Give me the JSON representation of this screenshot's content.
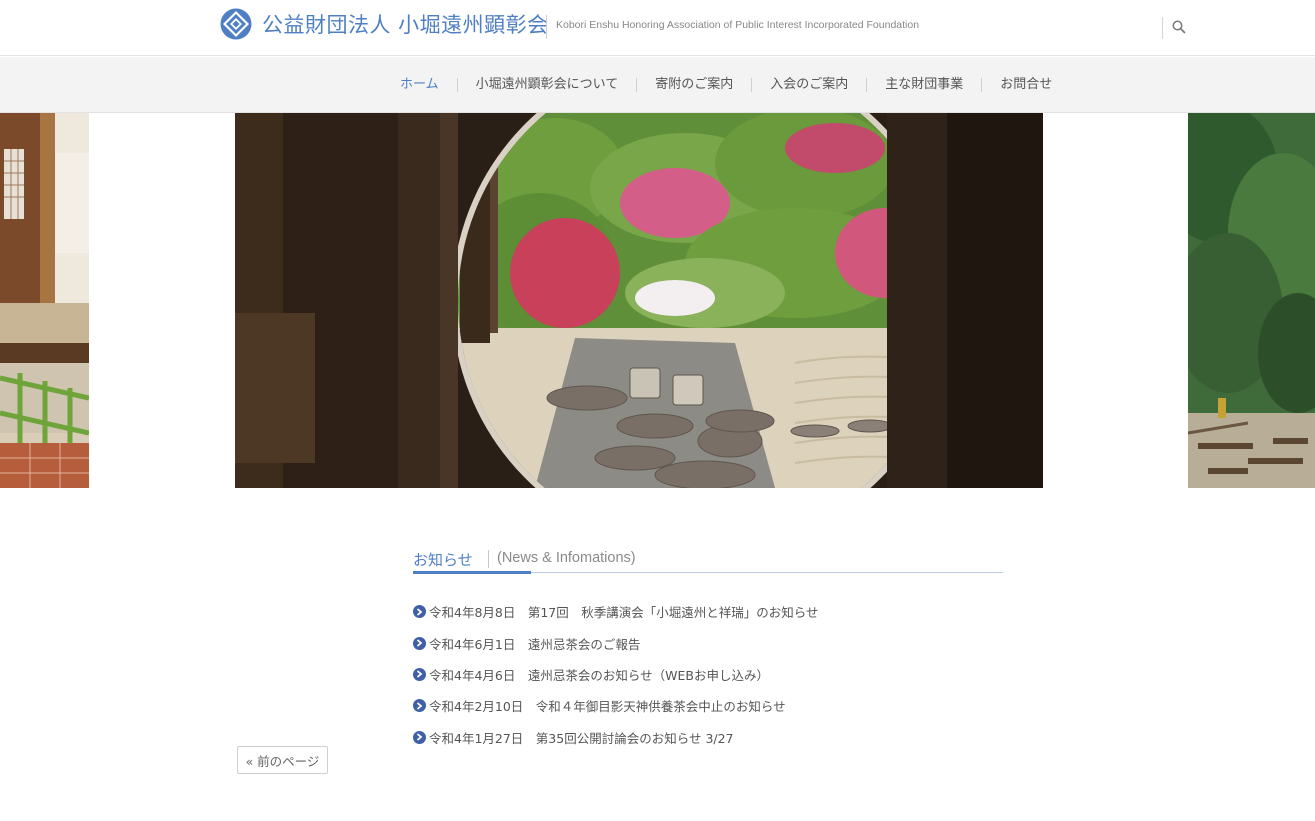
{
  "header": {
    "title": "公益財団法人 小堀遠州顕彰会",
    "subtitle": "Kobori Enshu Honoring Association of Public Interest Incorporated Foundation",
    "search_icon": "search-icon",
    "logo_icon": "diamond-crest-icon"
  },
  "nav": {
    "items": [
      {
        "label": "ホーム",
        "active": true
      },
      {
        "label": "小堀遠州顕彰会について",
        "active": false
      },
      {
        "label": "寄附のご案内",
        "active": false
      },
      {
        "label": "入会のご案内",
        "active": false
      },
      {
        "label": "主な財団事業",
        "active": false
      },
      {
        "label": "お問合せ",
        "active": false
      }
    ]
  },
  "news": {
    "title": "お知らせ",
    "subtitle": "(News & Infomations)",
    "items": [
      {
        "text": "令和4年8月8日　第17回　秋季講演会「小堀遠州と祥瑞」のお知らせ"
      },
      {
        "text": "令和4年6月1日　遠州忌茶会のご報告"
      },
      {
        "text": "令和4年4月6日　遠州忌茶会のお知らせ（WEBお申し込み）"
      },
      {
        "text": "令和4年2月10日　令和４年御目影天神供養茶会中止のお知らせ"
      },
      {
        "text": "令和4年1月27日　第35回公開討論会のお知らせ 3/27"
      }
    ]
  },
  "pager": {
    "prev_label": "« 前のページ"
  },
  "colors": {
    "accent": "#4f7fc4",
    "bullet": "#3f5fa8",
    "nav_bg": "#f3f3f3"
  }
}
